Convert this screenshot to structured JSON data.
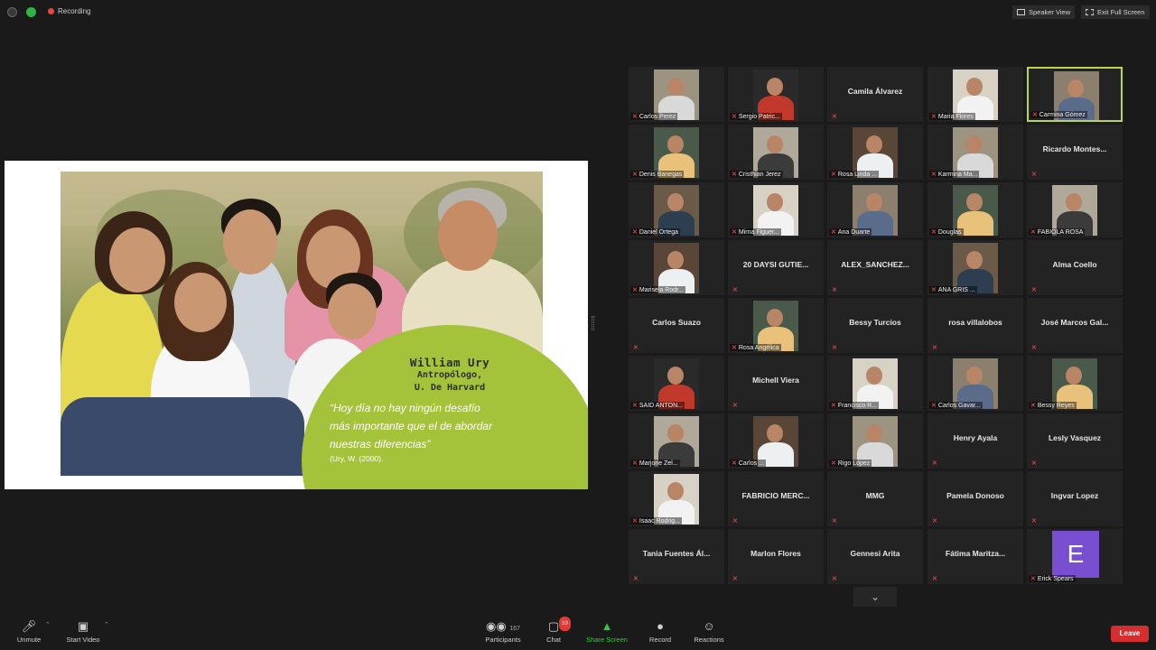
{
  "topbar": {
    "recording_label": "Recording",
    "speaker_view_label": "Speaker View",
    "exit_fullscreen_label": "Exit Full Screen"
  },
  "slide": {
    "author": "William Ury",
    "role_line1": "Antropólogo,",
    "role_line2": "U. De Harvard",
    "quote_line1": "“Hoy día no hay ningún desafío",
    "quote_line2": "más importante que el de abordar",
    "quote_line3": "nuestras diferencias”",
    "citation": "(Ury, W. (2000)."
  },
  "gallery": {
    "participants": [
      {
        "name": "Carlos Perez",
        "video": true
      },
      {
        "name": "Sergio Patric...",
        "video": true
      },
      {
        "name": "Camila Álvarez",
        "video": false
      },
      {
        "name": "Maria Flores",
        "video": true
      },
      {
        "name": "Carmina Gómez",
        "video": true
      },
      {
        "name": "Denis Banegas",
        "video": true
      },
      {
        "name": "Cristhian Jerez",
        "video": true
      },
      {
        "name": "Rosa Linda ...",
        "video": true
      },
      {
        "name": "Karmina Ma...",
        "video": true
      },
      {
        "name": "Ricardo Montes...",
        "video": false
      },
      {
        "name": "Daniel Ortega",
        "video": true
      },
      {
        "name": "Mirna Figuer...",
        "video": true
      },
      {
        "name": "Ana Duarte",
        "video": true
      },
      {
        "name": "Douglas",
        "video": true
      },
      {
        "name": "FABIOLA ROSA",
        "video": true
      },
      {
        "name": "Marisela Rodr...",
        "video": true
      },
      {
        "name": "20 DAYSI GUTIE...",
        "video": false
      },
      {
        "name": "ALEX_SANCHEZ...",
        "video": false
      },
      {
        "name": "ANA GRIS ...",
        "video": true
      },
      {
        "name": "Alma Coello",
        "video": false
      },
      {
        "name": "Carlos Suazo",
        "video": false
      },
      {
        "name": "Rosa Angélica",
        "video": true
      },
      {
        "name": "Bessy Turcios",
        "video": false
      },
      {
        "name": "rosa villalobos",
        "video": false
      },
      {
        "name": "José Marcos Gal...",
        "video": false
      },
      {
        "name": "SAID ANTON...",
        "video": true
      },
      {
        "name": "Michell Viera",
        "video": false
      },
      {
        "name": "Francisco R...",
        "video": true
      },
      {
        "name": "Carlos Gavar...",
        "video": true
      },
      {
        "name": "Bessy Reyes",
        "video": true
      },
      {
        "name": "Marjorie Zel...",
        "video": true
      },
      {
        "name": "Carlos ...",
        "video": true
      },
      {
        "name": "Rigo López",
        "video": true
      },
      {
        "name": "Henry Ayala",
        "video": false
      },
      {
        "name": "Lesly Vasquez",
        "video": false
      },
      {
        "name": "Isaac Rodrig...",
        "video": true
      },
      {
        "name": "FABRICIO MERC...",
        "video": false
      },
      {
        "name": "MMG",
        "video": false
      },
      {
        "name": "Pamela Donoso",
        "video": false
      },
      {
        "name": "Ingvar Lopez",
        "video": false
      },
      {
        "name": "Tania Fuentes Ál...",
        "video": false
      },
      {
        "name": "Marlon Flores",
        "video": false
      },
      {
        "name": "Gennesi Arita",
        "video": false
      },
      {
        "name": "Fátima Maritza...",
        "video": false
      },
      {
        "name": "Erick Spears",
        "video": false,
        "avatar_letter": "E"
      }
    ],
    "active_index": 4
  },
  "toolbar": {
    "unmute_label": "Unmute",
    "start_video_label": "Start Video",
    "participants_label": "Participants",
    "participants_count": "167",
    "chat_label": "Chat",
    "chat_badge": "10",
    "share_screen_label": "Share Screen",
    "record_label": "Record",
    "reactions_label": "Reactions",
    "leave_label": "Leave"
  },
  "colors": {
    "accent_green": "#a5c33a",
    "share_green": "#2ecc40",
    "leave_red": "#d32f2f",
    "active_border": "#b8d64e",
    "mute_red": "#e53935"
  }
}
